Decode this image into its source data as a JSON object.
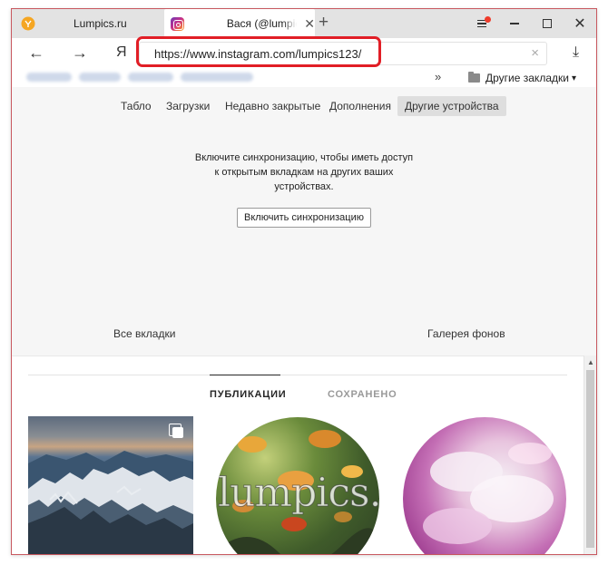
{
  "tabs": [
    {
      "title": "Lumpics.ru",
      "icon": "yandex-icon"
    },
    {
      "title": "Вася (@lumpics",
      "icon": "instagram-icon"
    }
  ],
  "toolbar": {
    "new_tab": "+",
    "back": "←",
    "forward": "→",
    "yandex": "Я",
    "url": "https://www.instagram.com/lumpics123/",
    "clear": "×",
    "download": "⤓"
  },
  "bookmarks": {
    "more": "»",
    "folder": "Другие закладки"
  },
  "newtab_nav": {
    "items": [
      "Табло",
      "Загрузки",
      "Недавно закрытые",
      "Дополнения",
      "Другие устройства"
    ],
    "active": "Другие устройства"
  },
  "sync": {
    "message": "Включите синхронизацию, чтобы иметь доступ к открытым вкладкам на других ваших устройствах.",
    "button": "Включить синхронизацию"
  },
  "bottom_links": {
    "all_tabs": "Все вкладки",
    "gallery": "Галерея фонов"
  },
  "instagram": {
    "tabs": [
      "ПУБЛИКАЦИИ",
      "СОХРАНЕНО"
    ],
    "watermark": "lumpics.ru"
  },
  "colors": {
    "highlight": "#e11e26",
    "window_border": "#c8585f"
  }
}
